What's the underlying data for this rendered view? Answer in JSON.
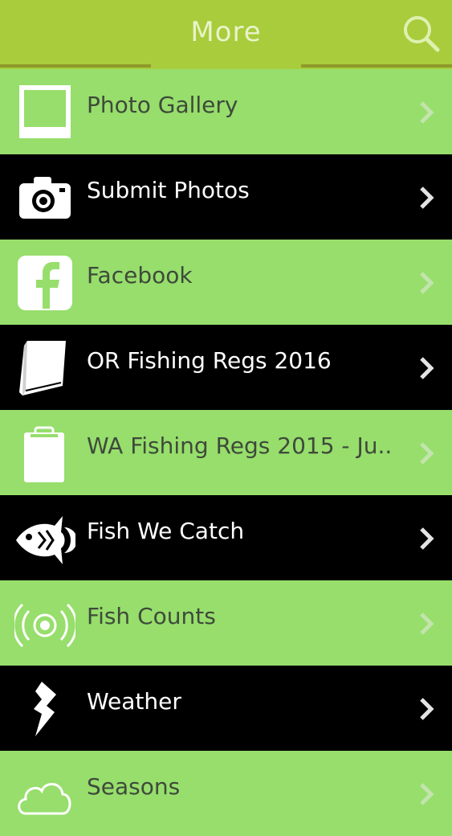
{
  "header": {
    "title": "More"
  },
  "menu": {
    "items": [
      {
        "label": "Photo Gallery",
        "icon": "photo-frame-icon"
      },
      {
        "label": "Submit Photos",
        "icon": "camera-icon"
      },
      {
        "label": "Facebook",
        "icon": "facebook-icon"
      },
      {
        "label": "OR Fishing Regs 2016",
        "icon": "book-icon"
      },
      {
        "label": "WA Fishing Regs 2015 - Ju...",
        "icon": "clipboard-icon"
      },
      {
        "label": "Fish We Catch",
        "icon": "fish-icon"
      },
      {
        "label": "Fish Counts",
        "icon": "signal-icon"
      },
      {
        "label": "Weather",
        "icon": "lightning-icon"
      },
      {
        "label": "Seasons",
        "icon": "cloud-icon"
      }
    ]
  },
  "colors": {
    "header_bg": "#a8cc3c",
    "light_row": "#97de6c",
    "dark_row": "#000000"
  }
}
